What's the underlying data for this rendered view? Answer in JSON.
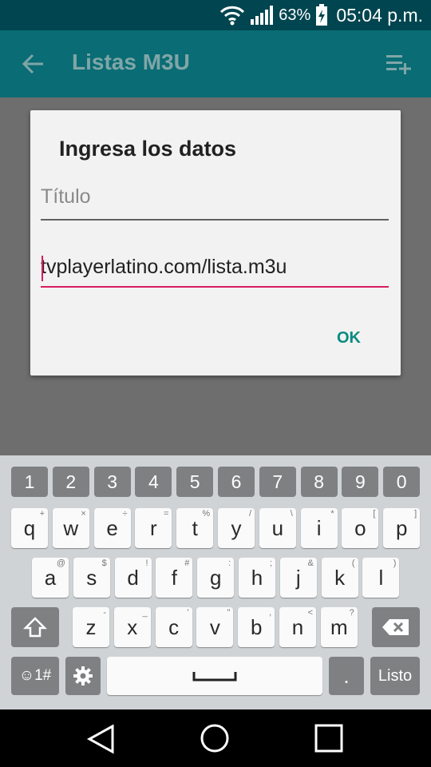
{
  "status_bar": {
    "battery": "63%",
    "time": "05:04 p.m."
  },
  "toolbar": {
    "title": "Listas M3U",
    "back_icon": "arrow-left-icon",
    "action_icon": "playlist-add-icon"
  },
  "dialog": {
    "title": "Ingresa los datos",
    "title_field": {
      "placeholder": "Título",
      "value": ""
    },
    "url_field": {
      "value": "tvplayerlatino.com/lista.m3u"
    },
    "ok_label": "OK"
  },
  "keyboard": {
    "numbers": [
      "1",
      "2",
      "3",
      "4",
      "5",
      "6",
      "7",
      "8",
      "9",
      "0"
    ],
    "row1": [
      {
        "k": "q",
        "s": "+"
      },
      {
        "k": "w",
        "s": "×"
      },
      {
        "k": "e",
        "s": "÷"
      },
      {
        "k": "r",
        "s": "="
      },
      {
        "k": "t",
        "s": "%"
      },
      {
        "k": "y",
        "s": "/"
      },
      {
        "k": "u",
        "s": "\\"
      },
      {
        "k": "i",
        "s": "*"
      },
      {
        "k": "o",
        "s": "["
      },
      {
        "k": "p",
        "s": "]"
      }
    ],
    "row2": [
      {
        "k": "a",
        "s": "@"
      },
      {
        "k": "s",
        "s": "$"
      },
      {
        "k": "d",
        "s": "!"
      },
      {
        "k": "f",
        "s": "#"
      },
      {
        "k": "g",
        "s": ":"
      },
      {
        "k": "h",
        "s": ";"
      },
      {
        "k": "j",
        "s": "&"
      },
      {
        "k": "k",
        "s": "("
      },
      {
        "k": "l",
        "s": ")"
      }
    ],
    "row3": [
      {
        "k": "z",
        "s": "-"
      },
      {
        "k": "x",
        "s": "_"
      },
      {
        "k": "c",
        "s": "'"
      },
      {
        "k": "v",
        "s": "\""
      },
      {
        "k": "b",
        "s": ","
      },
      {
        "k": "n",
        "s": "<"
      },
      {
        "k": "m",
        "s": "?"
      }
    ],
    "symbols_label": "☺1#",
    "period_label": ".",
    "done_label": "Listo"
  },
  "colors": {
    "appbar": "#0a6c74",
    "accent": "#d81b60",
    "ok": "#0a8a80"
  }
}
